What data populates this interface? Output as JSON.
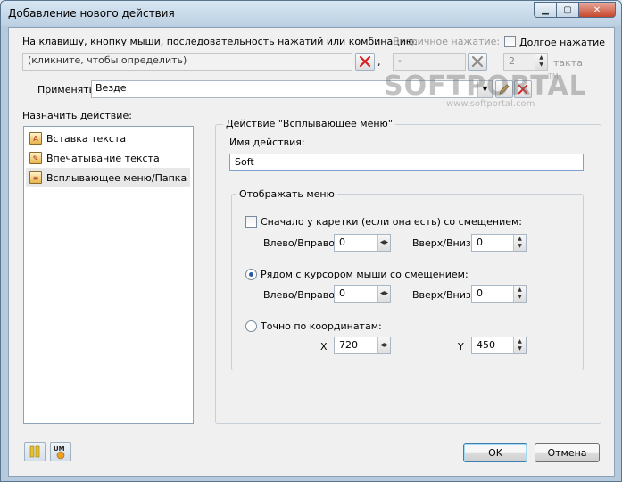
{
  "window": {
    "title": "Добавление нового действия"
  },
  "trigger": {
    "label": "На клавишу, кнопку мыши, последовательность нажатий или комбинацию:",
    "value": "(кликните, чтобы определить)",
    "comma": ",",
    "secondary_label": "Вторичное нажатие:",
    "secondary_value": "-",
    "long_press_label": "Долгое нажатие",
    "long_press_checked": false,
    "ticks_value": "2",
    "ticks_unit": "такта"
  },
  "apply": {
    "label": "Применять",
    "value": "Везде"
  },
  "actions": {
    "label": "Назначить действие:",
    "items": [
      {
        "label": "Вставка текста",
        "icon": "paste-text-icon"
      },
      {
        "label": "Впечатывание текста",
        "icon": "type-text-icon"
      },
      {
        "label": "Всплывающее меню/Папка",
        "icon": "popup-menu-folder-icon"
      }
    ],
    "selected_index": 2
  },
  "action_panel": {
    "title": "Действие \"Всплывающее меню\"",
    "name_label": "Имя действия:",
    "name_value": "Soft"
  },
  "display_menu": {
    "title": "Отображать меню",
    "option_caret": {
      "label": "Сначало у каретки (если она есть) со смещением:",
      "checked": false,
      "lr_label": "Влево/Вправо",
      "lr_value": "0",
      "ud_label": "Вверх/Вниз",
      "ud_value": "0"
    },
    "option_cursor": {
      "label": "Рядом с курсором мыши со смещением:",
      "selected": true,
      "lr_label": "Влево/Вправо",
      "lr_value": "0",
      "ud_label": "Вверх/Вниз",
      "ud_value": "0"
    },
    "option_coords": {
      "label": "Точно по координатам:",
      "selected": false,
      "x_label": "X",
      "x_value": "720",
      "y_label": "Y",
      "y_value": "450"
    }
  },
  "buttons": {
    "ok": "OK",
    "cancel": "Отмена"
  },
  "watermark": {
    "logo": "SOFTPORTAL",
    "tm": "TM",
    "url": "www.softportal.com"
  }
}
